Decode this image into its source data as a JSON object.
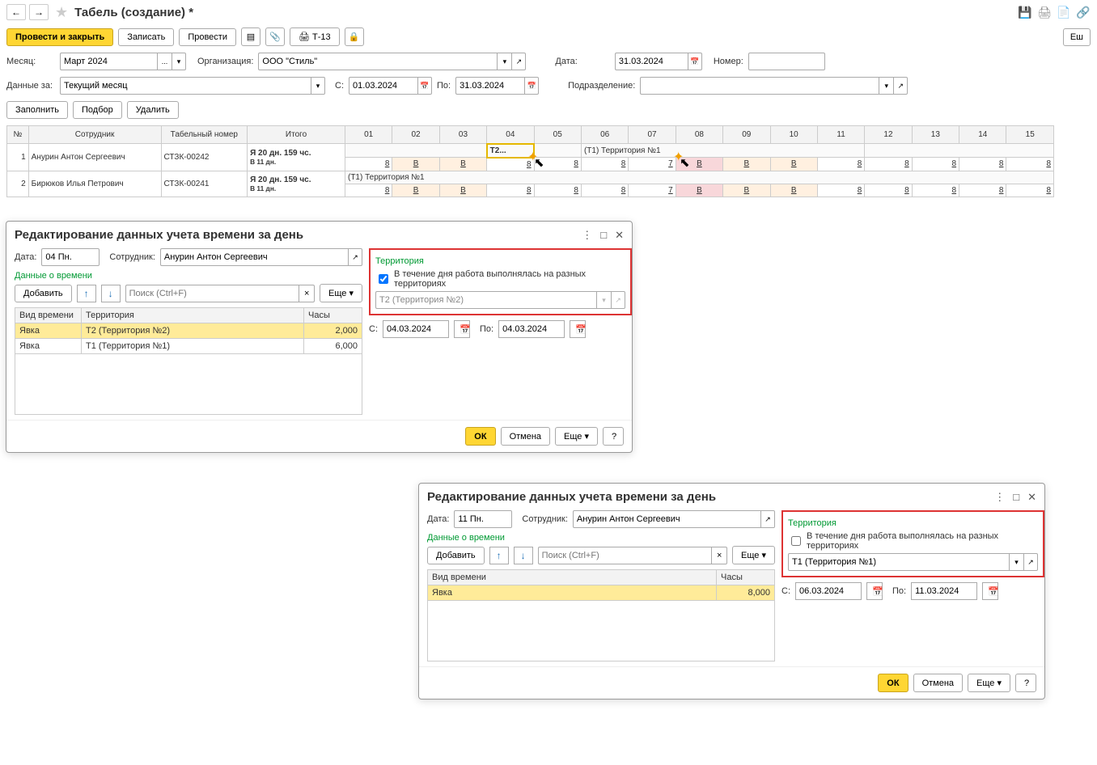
{
  "header": {
    "title": "Табель (создание) *"
  },
  "toolbar": {
    "post_close": "Провести и закрыть",
    "save": "Записать",
    "post": "Провести",
    "t13": "Т-13",
    "more": "Еш"
  },
  "form": {
    "month_label": "Месяц:",
    "month_value": "Март 2024",
    "org_label": "Организация:",
    "org_value": "ООО \"Стиль\"",
    "date_label": "Дата:",
    "date_value": "31.03.2024",
    "number_label": "Номер:",
    "number_value": "",
    "data_for_label": "Данные за:",
    "data_for_value": "Текущий месяц",
    "from_label": "С:",
    "from_value": "01.03.2024",
    "to_label": "По:",
    "to_value": "31.03.2024",
    "division_label": "Подразделение:",
    "division_value": ""
  },
  "buttons": {
    "fill": "Заполнить",
    "pick": "Подбор",
    "delete": "Удалить"
  },
  "table": {
    "col_num": "№",
    "col_employee": "Сотрудник",
    "col_tabnum": "Табельный номер",
    "col_total": "Итого",
    "days": [
      "01",
      "02",
      "03",
      "04",
      "05",
      "06",
      "07",
      "08",
      "09",
      "10",
      "11",
      "12",
      "13",
      "14",
      "15"
    ],
    "rows": [
      {
        "n": "1",
        "employee": "Анурин Антон Сергеевич",
        "tabnum": "СТЗК-00242",
        "total_line1": "Я 20 дн. 159 чс.",
        "total_line2": "В 11 дн.",
        "territory_04": "Т2...",
        "territory_06": "(Т1) Территория №1",
        "vals": [
          "8",
          "В",
          "В",
          "8",
          "8",
          "8",
          "7",
          "В",
          "В",
          "В",
          "8",
          "8",
          "8",
          "8",
          "8"
        ]
      },
      {
        "n": "2",
        "employee": "Бирюков Илья Петрович",
        "tabnum": "СТЗК-00241",
        "total_line1": "Я 20 дн. 159 чс.",
        "total_line2": "В 11 дн.",
        "territory": "(Т1) Территория №1",
        "vals": [
          "8",
          "В",
          "В",
          "8",
          "8",
          "8",
          "7",
          "В",
          "В",
          "В",
          "8",
          "8",
          "8",
          "8",
          "8"
        ]
      }
    ]
  },
  "dialog1": {
    "title": "Редактирование данных учета времени за день",
    "date_label": "Дата:",
    "date_value": "04 Пн.",
    "emp_label": "Сотрудник:",
    "emp_value": "Анурин Антон Сергеевич",
    "time_section": "Данные о времени",
    "add": "Добавить",
    "search_placeholder": "Поиск (Ctrl+F)",
    "more": "Еще",
    "col_type": "Вид времени",
    "col_territory": "Территория",
    "col_hours": "Часы",
    "rows": [
      {
        "type": "Явка",
        "territory": "Т2 (Территория №2)",
        "hours": "2,000"
      },
      {
        "type": "Явка",
        "territory": "Т1 (Территория №1)",
        "hours": "6,000"
      }
    ],
    "territory_section": "Территория",
    "chk_label": "В течение дня работа выполнялась на разных территориях",
    "territory_field": "Т2 (Территория №2)",
    "from_label": "С:",
    "from_value": "04.03.2024",
    "to_label": "По:",
    "to_value": "04.03.2024",
    "ok": "ОК",
    "cancel": "Отмена"
  },
  "dialog2": {
    "title": "Редактирование данных учета времени за день",
    "date_label": "Дата:",
    "date_value": "11 Пн.",
    "emp_label": "Сотрудник:",
    "emp_value": "Анурин Антон Сергеевич",
    "time_section": "Данные о времени",
    "add": "Добавить",
    "search_placeholder": "Поиск (Ctrl+F)",
    "more": "Еще",
    "col_type": "Вид времени",
    "col_hours": "Часы",
    "rows": [
      {
        "type": "Явка",
        "hours": "8,000"
      }
    ],
    "territory_section": "Территория",
    "chk_label": "В течение дня работа выполнялась на разных территориях",
    "territory_field": "Т1 (Территория №1)",
    "from_label": "С:",
    "from_value": "06.03.2024",
    "to_label": "По:",
    "to_value": "11.03.2024",
    "ok": "ОК",
    "cancel": "Отмена",
    "help": "?"
  },
  "common": {
    "help": "?"
  }
}
